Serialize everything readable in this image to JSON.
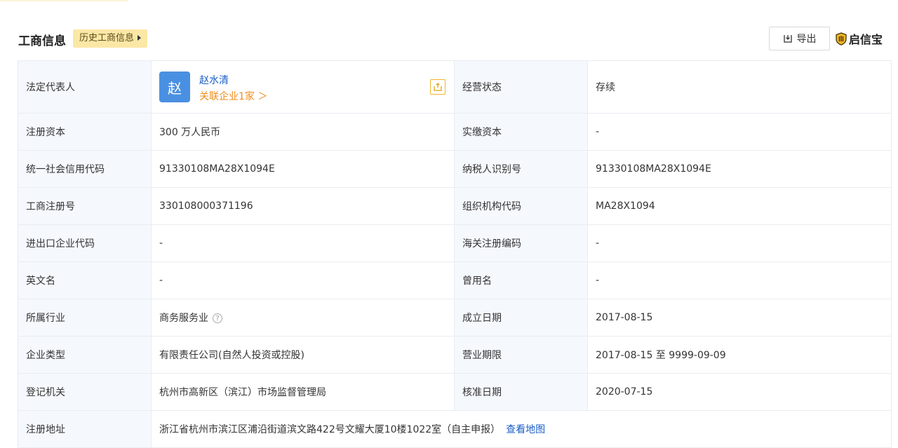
{
  "header": {
    "title": "工商信息",
    "history_tag": "历史工商信息",
    "export_label": "导出",
    "brand": "启信宝",
    "brand_color": "#f0b429"
  },
  "legal": {
    "label": "法定代表人",
    "avatar_char": "赵",
    "name": "赵水清",
    "related": "关联企业1家 ＞"
  },
  "status": {
    "label": "经营状态",
    "value": "存续"
  },
  "rows": [
    {
      "l1": "注册资本",
      "v1": "300 万人民币",
      "l2": "实缴资本",
      "v2": "-"
    },
    {
      "l1": "统一社会信用代码",
      "v1": "91330108MA28X1094E",
      "l2": "纳税人识别号",
      "v2": "91330108MA28X1094E"
    },
    {
      "l1": "工商注册号",
      "v1": "330108000371196",
      "l2": "组织机构代码",
      "v2": "MA28X1094"
    },
    {
      "l1": "进出口企业代码",
      "v1": "-",
      "l2": "海关注册编码",
      "v2": "-"
    },
    {
      "l1": "英文名",
      "v1": "-",
      "l2": "曾用名",
      "v2": "-"
    },
    {
      "l1": "所属行业",
      "v1": "商务服务业",
      "l2": "成立日期",
      "v2": "2017-08-15"
    },
    {
      "l1": "企业类型",
      "v1": "有限责任公司(自然人投资或控股)",
      "l2": "营业期限",
      "v2": "2017-08-15 至 9999-09-09"
    },
    {
      "l1": "登记机关",
      "v1": "杭州市高新区（滨江）市场监督管理局",
      "l2": "核准日期",
      "v2": "2020-07-15"
    }
  ],
  "address": {
    "label": "注册地址",
    "value": "浙江省杭州市滨江区浦沿街道滨文路422号文耀大厦10楼1022室（自主申报）",
    "map_link": "查看地图"
  },
  "help_glyph": "?"
}
